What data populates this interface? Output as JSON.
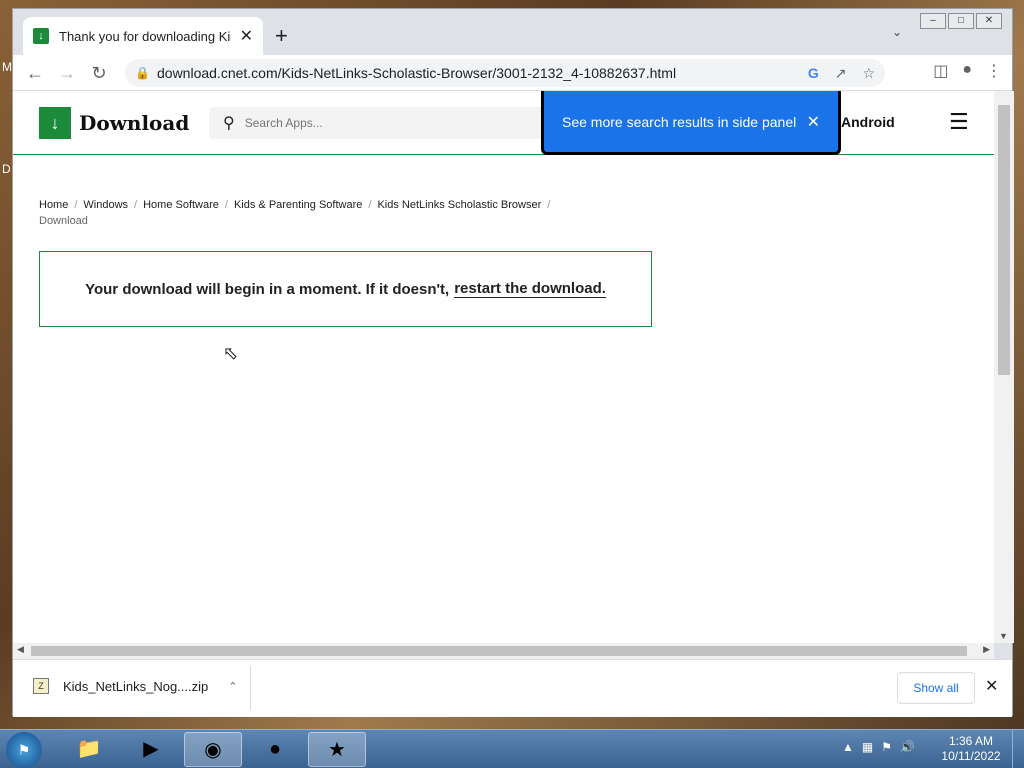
{
  "browser": {
    "tab_title": "Thank you for downloading Kids",
    "url": "download.cnet.com/Kids-NetLinks-Scholastic-Browser/3001-2132_4-10882637.html"
  },
  "site": {
    "logo_text": "Download",
    "search_placeholder": "Search Apps...",
    "android_label": "Android"
  },
  "popup": {
    "text": "See more search results in side panel"
  },
  "breadcrumb": {
    "items": [
      "Home",
      "Windows",
      "Home Software",
      "Kids & Parenting Software",
      "Kids NetLinks Scholastic Browser",
      "Download"
    ]
  },
  "download_box": {
    "message": "Your download will begin in a moment. If it doesn't,",
    "link": "restart the download."
  },
  "download_bar": {
    "filename": "Kids_NetLinks_Nog....zip",
    "show_all": "Show all"
  },
  "taskbar": {
    "time": "1:36 AM",
    "date": "10/11/2022"
  },
  "desktop": {
    "left_glyph_1": "M",
    "left_glyph_2": "D"
  },
  "colors": {
    "brand_green": "#1b8a3a",
    "popup_blue": "#1a73e8"
  }
}
